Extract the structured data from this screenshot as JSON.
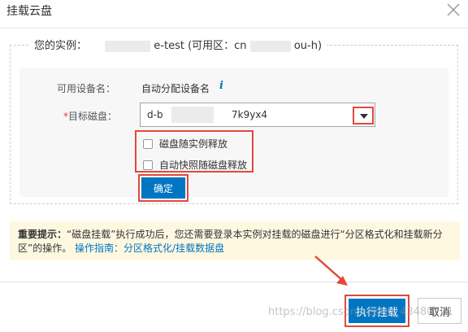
{
  "dialog": {
    "title": "挂载云盘"
  },
  "instance": {
    "label": "您的实例：",
    "name_suffix": "e-test (可用区：cn",
    "zone_suffix": "ou-h)"
  },
  "form": {
    "device_label": "可用设备名：",
    "device_value": "自动分配设备名",
    "info_icon_glyph": "i",
    "disk_label_star": "*",
    "disk_label": "目标磁盘：",
    "disk_value_prefix": "d-b",
    "disk_value_suffix": "7k9yx4",
    "checkbox_release_with_instance": "磁盘随实例释放",
    "checkbox_snapshot_release": "自动快照随磁盘释放",
    "confirm_label": "确定"
  },
  "notice": {
    "title": "重要提示：",
    "text": "“磁盘挂载”执行成功后，您还需要登录本实例对挂载的磁盘进行“分区格式化和挂载新分区”的操作。",
    "link": "操作指南：分区格式化/挂载数据盘"
  },
  "footer": {
    "execute_label": "执行挂载",
    "cancel_label": "取消",
    "watermark": "https://blog.csdn.net/qq_43480701"
  },
  "colors": {
    "primary": "#0075c2",
    "highlight": "#e2483a",
    "notice_bg": "#fff8e1"
  },
  "icons": [
    "close-icon",
    "info-icon",
    "dropdown-arrow-icon",
    "annotation-arrow-icon"
  ]
}
